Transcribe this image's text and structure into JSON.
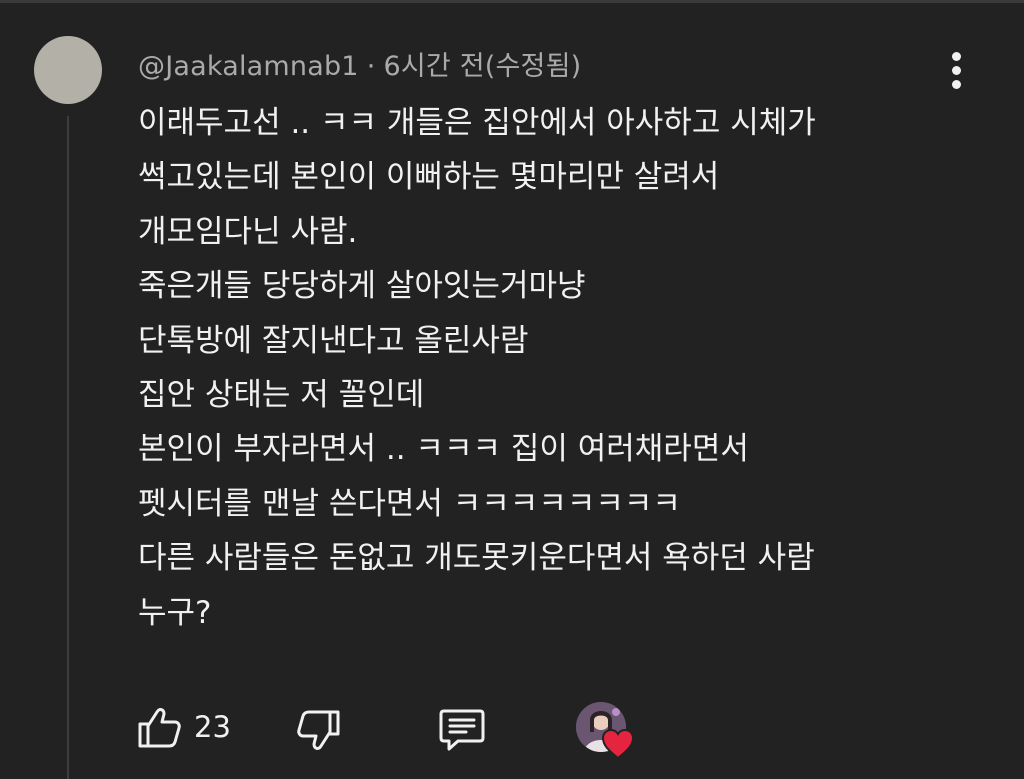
{
  "comment": {
    "author": "@Jaakalamnab1",
    "separator": "·",
    "timestamp": "6시간 전(수정됨)",
    "lines": [
      "이래두고선 .. ㅋㅋ 개들은 집안에서 아사하고 시체가",
      "썩고있는데 본인이 이뻐하는 몇마리만 살려서",
      "개모임다닌 사람.",
      "죽은개들 당당하게 살아잇는거마냥",
      "단톡방에 잘지낸다고 올린사람",
      "집안 상태는 저 꼴인데",
      "본인이 부자라면서 .. ㅋㅋㅋ 집이 여러채라면서",
      "펫시터를 맨날 쓴다면서 ㅋㅋㅋㅋㅋㅋㅋㅋ",
      "다른 사람들은 돈없고 개도못키운다면서 욕하던 사람",
      "누구?"
    ]
  },
  "actions": {
    "like_count": "23",
    "like_icon": "thumbs-up-icon",
    "dislike_icon": "thumbs-down-icon",
    "reply_icon": "comment-reply-icon",
    "creator_heart_icon": "heart-icon"
  },
  "colors": {
    "background": "#222222",
    "text": "#f1f1f1",
    "meta_text": "#aaaaaa",
    "avatar_placeholder": "#b3b0a8",
    "heart": "#e5253f"
  }
}
